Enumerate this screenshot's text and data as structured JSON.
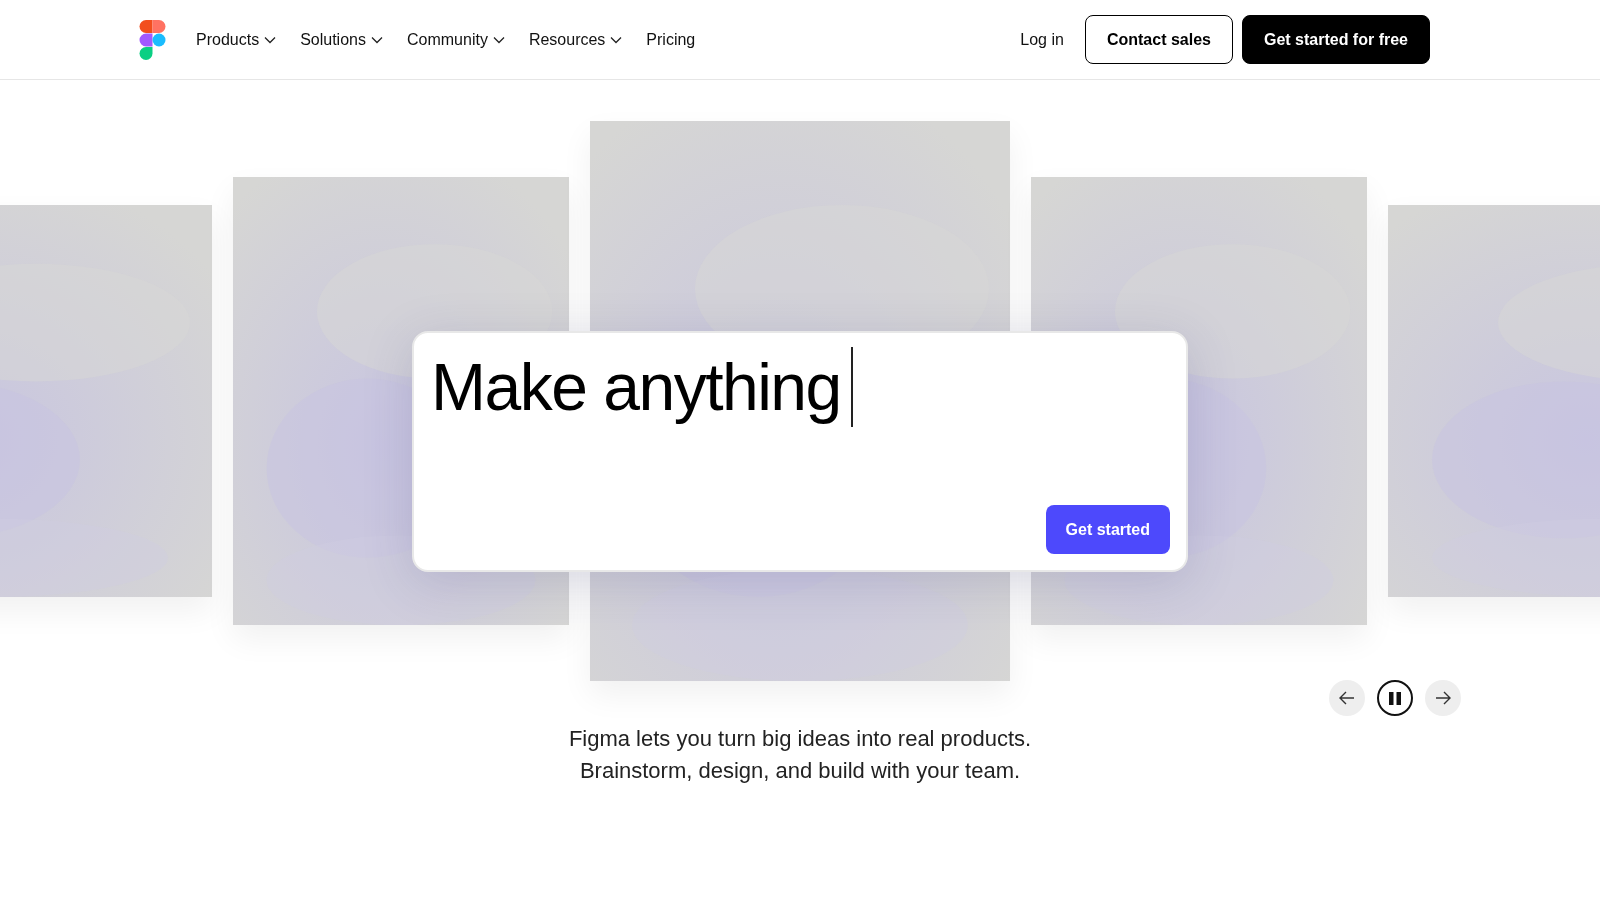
{
  "nav": {
    "items": [
      {
        "label": "Products",
        "dropdown": true
      },
      {
        "label": "Solutions",
        "dropdown": true
      },
      {
        "label": "Community",
        "dropdown": true
      },
      {
        "label": "Resources",
        "dropdown": true
      },
      {
        "label": "Pricing",
        "dropdown": false
      }
    ],
    "login": "Log in",
    "contact": "Contact sales",
    "cta": "Get started for free"
  },
  "hero": {
    "prompt": "Make anything",
    "button": "Get started",
    "carousel": {
      "playing": true
    },
    "tagline": [
      "Figma lets you turn big ideas into real products.",
      "Brainstorm, design, and build with your team."
    ]
  }
}
